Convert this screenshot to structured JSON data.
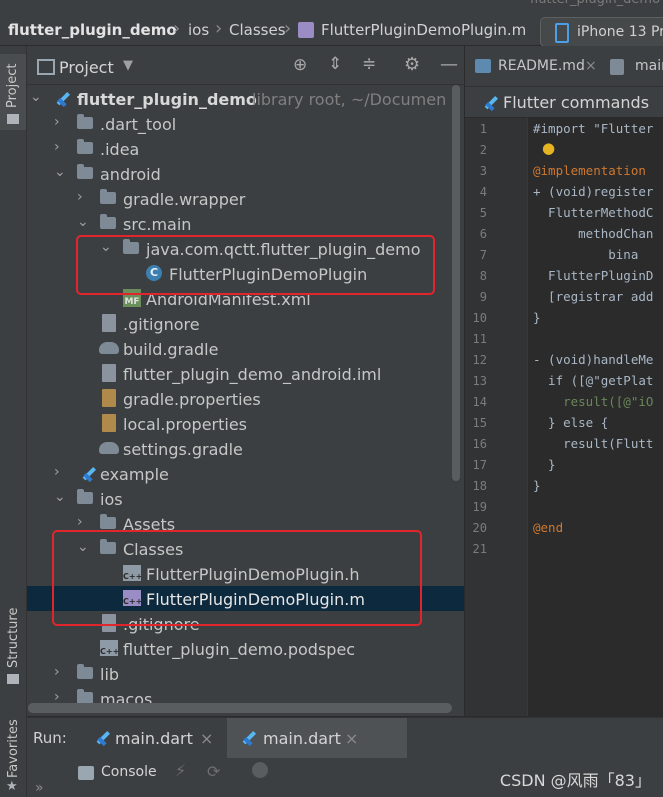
{
  "window": {
    "title_sliver": "flutter_plugin_demo"
  },
  "breadcrumb": {
    "items": [
      "flutter_plugin_demo",
      "ios",
      "Classes",
      "FlutterPluginDemoPlugin.m"
    ]
  },
  "device_selector": {
    "label": "iPhone 13 Pr"
  },
  "left_stripe": {
    "project": "Project",
    "structure": "Structure",
    "favorites": "Favorites"
  },
  "project_panel": {
    "title": "Project",
    "tree": [
      {
        "label": "flutter_plugin_demo",
        "hint": "library root, ~/Documen"
      },
      {
        "label": ".dart_tool"
      },
      {
        "label": ".idea"
      },
      {
        "label": "android"
      },
      {
        "label": "gradle.wrapper"
      },
      {
        "label": "src.main"
      },
      {
        "label": "java.com.qctt.flutter_plugin_demo"
      },
      {
        "label": "FlutterPluginDemoPlugin"
      },
      {
        "label": "AndroidManifest.xml"
      },
      {
        "label": ".gitignore"
      },
      {
        "label": "build.gradle"
      },
      {
        "label": "flutter_plugin_demo_android.iml"
      },
      {
        "label": "gradle.properties"
      },
      {
        "label": "local.properties"
      },
      {
        "label": "settings.gradle"
      },
      {
        "label": "example"
      },
      {
        "label": "ios"
      },
      {
        "label": "Assets"
      },
      {
        "label": "Classes"
      },
      {
        "label": "FlutterPluginDemoPlugin.h"
      },
      {
        "label": "FlutterPluginDemoPlugin.m"
      },
      {
        "label": ".gitignore"
      },
      {
        "label": "flutter_plugin_demo.podspec"
      },
      {
        "label": "lib"
      },
      {
        "label": "macos"
      }
    ]
  },
  "editor": {
    "tabs": [
      "README.md",
      "main"
    ],
    "flutter_commands": "Flutter commands",
    "lines": [
      "1",
      "2",
      "3",
      "4",
      "5",
      "6",
      "7",
      "8",
      "9",
      "10",
      "11",
      "12",
      "13",
      "14",
      "15",
      "16",
      "17",
      "18",
      "19",
      "20",
      "21"
    ],
    "code": {
      "l1": "#import \"Flutter",
      "l3": "@implementation",
      "l4": "+ (void)register",
      "l5": "  FlutterMethodC",
      "l6": "      methodChan",
      "l7": "          bina",
      "l8": "  FlutterPluginD",
      "l9": "  [registrar add",
      "l10": "}",
      "l12": "- (void)handleMe",
      "l13": "  if ([@\"getPlat",
      "l14": "    result([@\"iO",
      "l15": "  } else {",
      "l16": "    result(Flutt",
      "l17": "  }",
      "l18": "}",
      "l20": "@end"
    }
  },
  "run": {
    "label": "Run:",
    "tabs": [
      "main.dart",
      "main.dart"
    ]
  },
  "console": {
    "label": "Console"
  },
  "watermark": "CSDN @风雨「83」",
  "colors": {
    "highlight_border": "#e0262c",
    "selection": "#0d293e",
    "panel_bg": "#3c3f41",
    "editor_bg": "#2b2b2b"
  }
}
